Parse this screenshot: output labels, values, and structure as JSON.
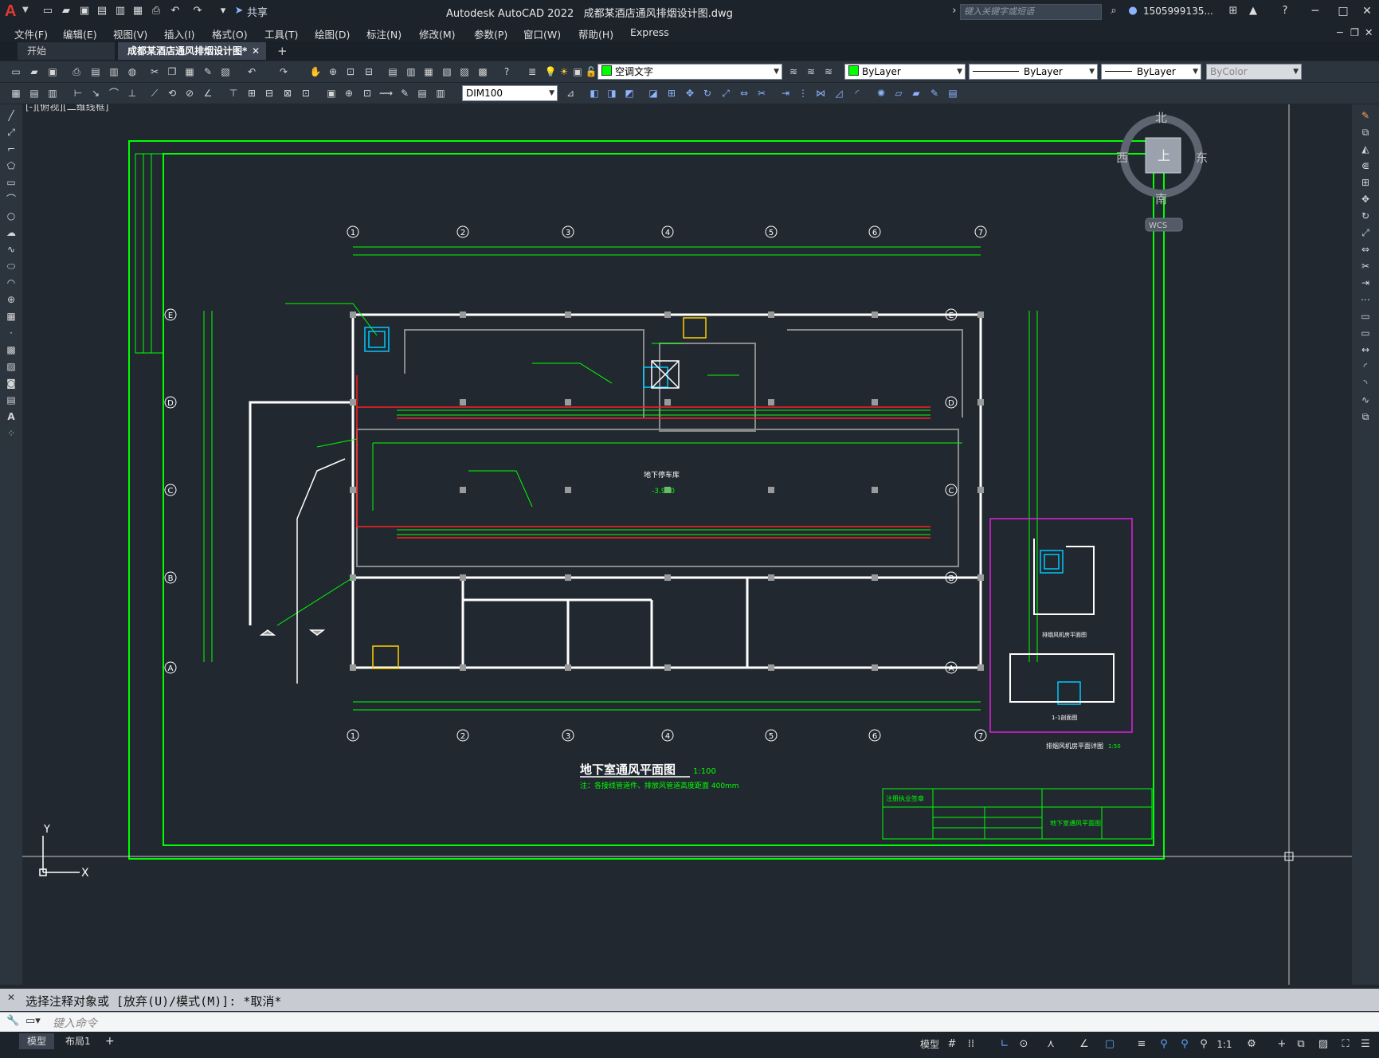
{
  "app": {
    "title": "Autodesk AutoCAD 2022",
    "file": "成都某酒店通风排烟设计图.dwg",
    "share_label": "共享",
    "search_placeholder": "键入关键字或短语",
    "user": "1505999135...",
    "logo_letter": "A"
  },
  "menu": [
    "文件(F)",
    "编辑(E)",
    "视图(V)",
    "插入(I)",
    "格式(O)",
    "工具(T)",
    "绘图(D)",
    "标注(N)",
    "修改(M)",
    "参数(P)",
    "窗口(W)",
    "帮助(H)",
    "Express"
  ],
  "tabs": {
    "start": "开始",
    "active": "成都某酒店通风排烟设计图*",
    "close": "✕",
    "add": "+"
  },
  "toolbar": {
    "layer": "空调文字",
    "color": "ByLayer",
    "linetype": "ByLayer",
    "lineweight": "ByLayer",
    "plotstyle": "ByColor",
    "dimstyle": "DIM100"
  },
  "viewport": {
    "label": "[-][俯视][二维线框]",
    "viewcube": {
      "north": "北",
      "south": "南",
      "east": "东",
      "west": "西",
      "top": "上",
      "wcs": "WCS"
    },
    "ucs": {
      "x": "X",
      "y": "Y"
    }
  },
  "drawing": {
    "grid_numbers": [
      "1",
      "2",
      "3",
      "4",
      "5",
      "6",
      "7"
    ],
    "grid_letters": [
      "E",
      "D",
      "C",
      "B",
      "A"
    ],
    "main_title": "地下室通风平面图",
    "main_scale": "1:100",
    "note": "注：各接线管道件、排放风管道高度距面 400mm",
    "center_label": "地下停车库",
    "elevation": "-3.900",
    "title_block": {
      "header": "注册执业签章",
      "sheet_name": "地下室通风平面图"
    },
    "inset_title": "排烟风机房平面详图",
    "inset_scale": "1:50",
    "inset_sub1": "排烟风机房平面图",
    "inset_sub2": "1-1剖面图"
  },
  "command": {
    "history": "选择注释对象或 [放弃(U)/模式(M)]: *取消*",
    "placeholder": "键入命令"
  },
  "status": {
    "tabs": [
      "模型",
      "布局1"
    ],
    "add": "+",
    "model": "模型",
    "scale": "1:1"
  }
}
